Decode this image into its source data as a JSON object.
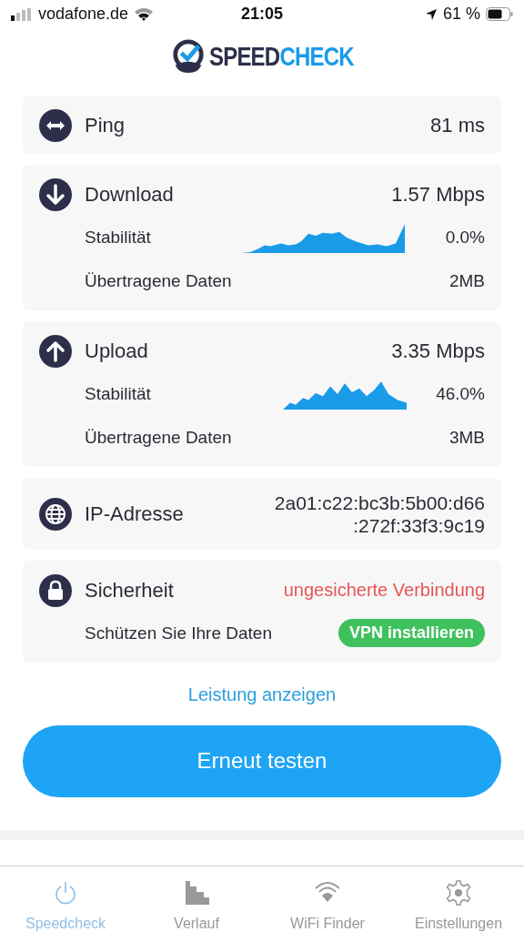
{
  "status_bar": {
    "carrier": "vodafone.de",
    "time": "21:05",
    "battery": "61 %"
  },
  "logo": {
    "part_1": "SPEED",
    "part_2": "CHECK"
  },
  "sections": [
    {
      "kind": "ping",
      "title": "Ping",
      "value": "81 ms"
    },
    {
      "kind": "download",
      "title": "Download",
      "value": "1.57 Mbps",
      "rows": [
        {
          "label": "Stabilität",
          "value": "0.0%"
        },
        {
          "label": "Übertragene Daten",
          "value": "2MB"
        }
      ]
    },
    {
      "kind": "upload",
      "title": "Upload",
      "value": "3.35 Mbps",
      "rows": [
        {
          "label": "Stabilität",
          "value": "46.0%"
        },
        {
          "label": "Übertragene Daten",
          "value": "3MB"
        }
      ]
    },
    {
      "kind": "ip",
      "title": "IP-Adresse",
      "value": "2a01:c22:bc3b:5b00:d66\n:272f:33f3:9c19"
    },
    {
      "kind": "security",
      "title": "Sicherheit",
      "value": "ungesicherte Verbindung",
      "note": "Schützen Sie Ihre Daten",
      "action": "VPN installieren"
    }
  ],
  "link": "Leistung anzeigen",
  "primary_button": "Erneut testen",
  "tabs": [
    {
      "label": "Speedcheck",
      "selected": true
    },
    {
      "label": "Verlauf",
      "selected": false
    },
    {
      "label": "WiFi Finder",
      "selected": false
    },
    {
      "label": "Einstellungen",
      "selected": false
    }
  ]
}
